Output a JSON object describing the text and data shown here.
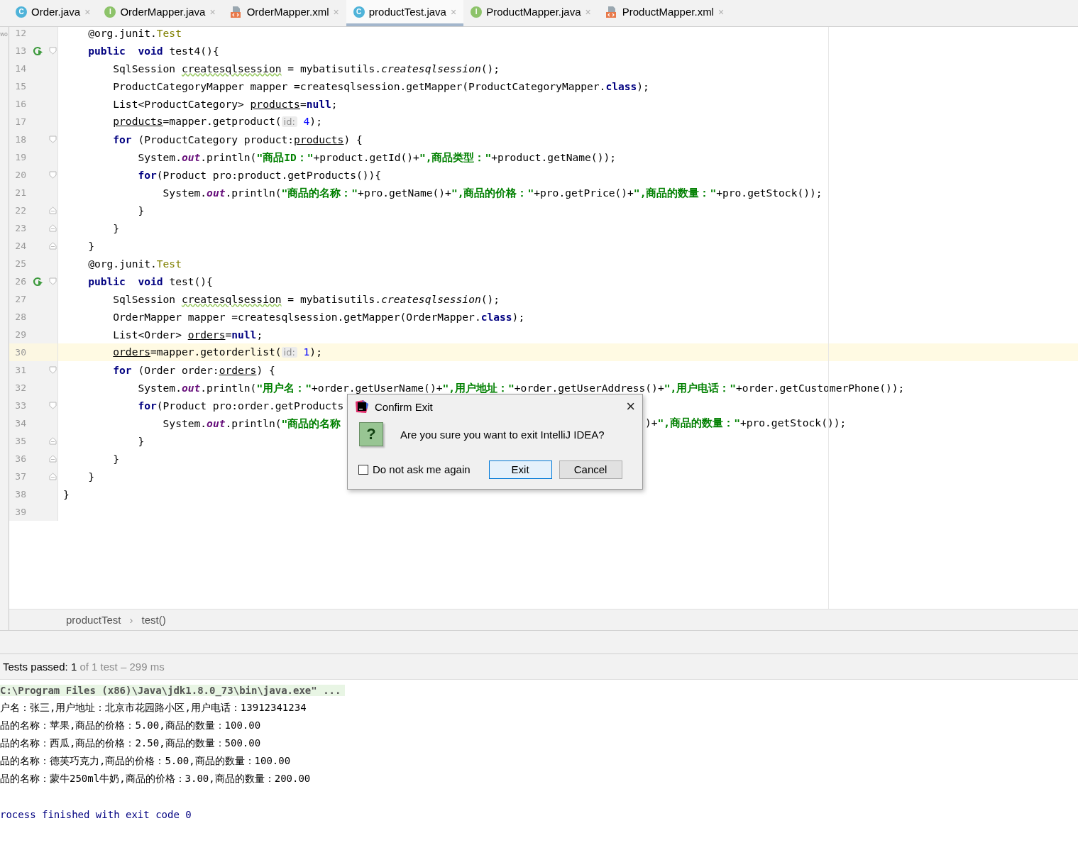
{
  "left_strip_text": "wo",
  "tabs": [
    {
      "label": "Order.java",
      "kind": "class",
      "badge": "C",
      "selected": false,
      "close": "×"
    },
    {
      "label": "OrderMapper.java",
      "kind": "interface",
      "badge": "I",
      "selected": false,
      "close": "×"
    },
    {
      "label": "OrderMapper.xml",
      "kind": "xml",
      "selected": false,
      "close": "×"
    },
    {
      "label": "productTest.java",
      "kind": "class",
      "badge": "C",
      "selected": true,
      "close": "×"
    },
    {
      "label": "ProductMapper.java",
      "kind": "interface",
      "badge": "I",
      "selected": false,
      "close": "×"
    },
    {
      "label": "ProductMapper.xml",
      "kind": "xml",
      "selected": false,
      "close": "×"
    }
  ],
  "editor": {
    "class_body": [
      {
        "n": "12",
        "tokens": [
          {
            "t": "@org.junit.",
            "kind": "plain"
          },
          {
            "t": "Test",
            "kind": "ann"
          }
        ]
      },
      {
        "n": "13",
        "run": true,
        "fold_open": true,
        "tokens": [
          {
            "t": "public  ",
            "kind": "kw"
          },
          {
            "t": "void",
            "kind": "kw"
          },
          {
            "t": " test4(){",
            "kind": "plain"
          }
        ],
        "children": [
          {
            "n": "14",
            "tokens": [
              {
                "t": "SqlSession ",
                "kind": "plain"
              },
              {
                "t": "createsqlsession",
                "kind": "wavy"
              },
              {
                "t": " = mybatisutils.",
                "kind": "plain"
              },
              {
                "t": "createsqlsession",
                "kind": "italic"
              },
              {
                "t": "();",
                "kind": "plain"
              }
            ]
          },
          {
            "n": "15",
            "tokens": [
              {
                "t": "ProductCategoryMapper mapper =createsqlsession.getMapper(ProductCategoryMapper.",
                "kind": "plain"
              },
              {
                "t": "class",
                "kind": "kw"
              },
              {
                "t": ");",
                "kind": "plain"
              }
            ]
          },
          {
            "n": "16",
            "tokens": [
              {
                "t": "List<ProductCategory> ",
                "kind": "plain"
              },
              {
                "t": "products",
                "kind": "under"
              },
              {
                "t": "=",
                "kind": "plain"
              },
              {
                "t": "null",
                "kind": "kw"
              },
              {
                "t": ";",
                "kind": "plain"
              }
            ]
          },
          {
            "n": "17",
            "tokens": [
              {
                "t": "products",
                "kind": "under"
              },
              {
                "t": "=mapper.getproduct(",
                "kind": "plain"
              },
              {
                "t": "id:",
                "kind": "hint"
              },
              {
                "t": " 4",
                "kind": "num"
              },
              {
                "t": ");",
                "kind": "plain"
              }
            ]
          },
          {
            "n": "18",
            "fold_open": true,
            "tokens": [
              {
                "t": "for",
                "kind": "kw"
              },
              {
                "t": " (ProductCategory product:",
                "kind": "plain"
              },
              {
                "t": "products",
                "kind": "under"
              },
              {
                "t": ") {",
                "kind": "plain"
              }
            ],
            "children": [
              {
                "n": "19",
                "tokens": [
                  {
                    "t": "System.",
                    "kind": "plain"
                  },
                  {
                    "t": "out",
                    "kind": "static"
                  },
                  {
                    "t": ".println(",
                    "kind": "plain"
                  },
                  {
                    "t": "\"商品ID：\"",
                    "kind": "str"
                  },
                  {
                    "t": "+product.getId()+",
                    "kind": "plain"
                  },
                  {
                    "t": "\",商品类型：\"",
                    "kind": "str"
                  },
                  {
                    "t": "+product.getName());",
                    "kind": "plain"
                  }
                ]
              },
              {
                "n": "20",
                "fold_open": true,
                "tokens": [
                  {
                    "t": "for",
                    "kind": "kw"
                  },
                  {
                    "t": "(Product pro:product.getProducts()){",
                    "kind": "plain"
                  }
                ],
                "children": [
                  {
                    "n": "21",
                    "tokens": [
                      {
                        "t": "System.",
                        "kind": "plain"
                      },
                      {
                        "t": "out",
                        "kind": "static"
                      },
                      {
                        "t": ".println(",
                        "kind": "plain"
                      },
                      {
                        "t": "\"商品的名称：\"",
                        "kind": "str"
                      },
                      {
                        "t": "+pro.getName()+",
                        "kind": "plain"
                      },
                      {
                        "t": "\",商品的价格：\"",
                        "kind": "str"
                      },
                      {
                        "t": "+pro.getPrice()+",
                        "kind": "plain"
                      },
                      {
                        "t": "\",商品的数量：\"",
                        "kind": "str"
                      },
                      {
                        "t": "+pro.getStock());",
                        "kind": "plain"
                      }
                    ]
                  }
                ]
              },
              {
                "n": "22",
                "fold_close": true,
                "tokens": [
                  {
                    "t": "}",
                    "kind": "plain"
                  }
                ]
              }
            ]
          },
          {
            "n": "23",
            "fold_close": true,
            "tokens": [
              {
                "t": "}",
                "kind": "plain"
              }
            ]
          }
        ]
      },
      {
        "n": "24",
        "fold_close": true,
        "tokens": [
          {
            "t": "}",
            "kind": "plain"
          }
        ]
      },
      {
        "n": "25",
        "tokens": [
          {
            "t": "@org.junit.",
            "kind": "plain"
          },
          {
            "t": "Test",
            "kind": "ann"
          }
        ]
      },
      {
        "n": "26",
        "run": true,
        "fold_open": true,
        "tokens": [
          {
            "t": "public  ",
            "kind": "kw"
          },
          {
            "t": "void",
            "kind": "kw"
          },
          {
            "t": " test(){",
            "kind": "plain"
          }
        ],
        "children": [
          {
            "n": "27",
            "tokens": [
              {
                "t": "SqlSession ",
                "kind": "plain"
              },
              {
                "t": "createsqlsession",
                "kind": "wavy"
              },
              {
                "t": " = mybatisutils.",
                "kind": "plain"
              },
              {
                "t": "createsqlsession",
                "kind": "italic"
              },
              {
                "t": "();",
                "kind": "plain"
              }
            ]
          },
          {
            "n": "28",
            "tokens": [
              {
                "t": "OrderMapper mapper =createsqlsession.getMapper(OrderMapper.",
                "kind": "plain"
              },
              {
                "t": "class",
                "kind": "kw"
              },
              {
                "t": ");",
                "kind": "plain"
              }
            ]
          },
          {
            "n": "29",
            "tokens": [
              {
                "t": "List<Order> ",
                "kind": "plain"
              },
              {
                "t": "orders",
                "kind": "under"
              },
              {
                "t": "=",
                "kind": "plain"
              },
              {
                "t": "null",
                "kind": "kw"
              },
              {
                "t": ";",
                "kind": "plain"
              }
            ]
          },
          {
            "n": "30",
            "current": true,
            "tokens": [
              {
                "t": "orders",
                "kind": "under"
              },
              {
                "t": "=mapper.getorderlist(",
                "kind": "plain"
              },
              {
                "t": "id:",
                "kind": "hint"
              },
              {
                "t": " 1",
                "kind": "num"
              },
              {
                "t": ");",
                "kind": "plain"
              }
            ]
          },
          {
            "n": "31",
            "fold_open": true,
            "tokens": [
              {
                "t": "for",
                "kind": "kw"
              },
              {
                "t": " (Order order:",
                "kind": "plain"
              },
              {
                "t": "orders",
                "kind": "under"
              },
              {
                "t": ") {",
                "kind": "plain"
              }
            ],
            "children": [
              {
                "n": "32",
                "tokens": [
                  {
                    "t": "System.",
                    "kind": "plain"
                  },
                  {
                    "t": "out",
                    "kind": "static"
                  },
                  {
                    "t": ".println(",
                    "kind": "plain"
                  },
                  {
                    "t": "\"用户名：\"",
                    "kind": "str"
                  },
                  {
                    "t": "+order.getUserName()+",
                    "kind": "plain"
                  },
                  {
                    "t": "\",用户地址：\"",
                    "kind": "str"
                  },
                  {
                    "t": "+order.getUserAddress()+",
                    "kind": "plain"
                  },
                  {
                    "t": "\",用户电话：\"",
                    "kind": "str"
                  },
                  {
                    "t": "+order.getCustomerPhone());",
                    "kind": "plain"
                  }
                ]
              },
              {
                "n": "33",
                "fold_open": true,
                "tokens": [
                  {
                    "t": "for",
                    "kind": "kw"
                  },
                  {
                    "t": "(Product pro:order.getProducts",
                    "kind": "plain"
                  }
                ],
                "children": [
                  {
                    "n": "34",
                    "tokens": [
                      {
                        "t": "System.",
                        "kind": "plain"
                      },
                      {
                        "t": "out",
                        "kind": "static"
                      },
                      {
                        "t": ".println(",
                        "kind": "plain"
                      },
                      {
                        "t": "\"商品的名称",
                        "kind": "str"
                      }
                    ],
                    "tail": [
                      {
                        "t": ")+",
                        "kind": "plain"
                      },
                      {
                        "t": "\",商品的数量：\"",
                        "kind": "str"
                      },
                      {
                        "t": "+pro.getStock());",
                        "kind": "plain"
                      }
                    ]
                  }
                ]
              },
              {
                "n": "35",
                "fold_close": true,
                "tokens": [
                  {
                    "t": "}",
                    "kind": "plain"
                  }
                ]
              }
            ]
          },
          {
            "n": "36",
            "fold_close": true,
            "tokens": [
              {
                "t": "}",
                "kind": "plain"
              }
            ]
          }
        ]
      },
      {
        "n": "37",
        "fold_close": true,
        "tokens": [
          {
            "t": "}",
            "kind": "plain"
          }
        ]
      }
    ],
    "lines_after": [
      {
        "n": "38",
        "tokens": [
          {
            "t": "}",
            "kind": "plain"
          }
        ]
      },
      {
        "n": "39"
      }
    ]
  },
  "breadcrumb": {
    "items": [
      "productTest",
      "test()"
    ],
    "separator": "›"
  },
  "run_panel": {
    "status": "Tests passed: ",
    "count": "1",
    "detail": " of 1 test – 299 ms"
  },
  "console": [
    {
      "text": "C:\\Program Files (x86)\\Java\\jdk1.8.0_73\\bin\\java.exe\" ...",
      "kind": "command"
    },
    {
      "text": "户名：张三,用户地址：北京市花园路小区,用户电话：13912341234",
      "kind": "output"
    },
    {
      "text": "品的名称：苹果,商品的价格：5.00,商品的数量：100.00",
      "kind": "output"
    },
    {
      "text": "品的名称：西瓜,商品的价格：2.50,商品的数量：500.00",
      "kind": "output"
    },
    {
      "text": "品的名称：德芙巧克力,商品的价格：5.00,商品的数量：100.00",
      "kind": "output"
    },
    {
      "text": "品的名称：蒙牛250ml牛奶,商品的价格：3.00,商品的数量：200.00",
      "kind": "output"
    },
    {
      "kind": "blank"
    },
    {
      "text": "rocess finished with exit code 0",
      "kind": "system"
    }
  ],
  "dialog": {
    "title": "Confirm Exit",
    "close": "×",
    "icon_glyph": "?",
    "message": "Are you sure you want to exit IntelliJ IDEA?",
    "checkbox": {
      "label": "Do not ask me again",
      "checked": false
    },
    "buttons": [
      {
        "label": "Exit",
        "default": true
      },
      {
        "label": "Cancel",
        "default": false
      }
    ]
  }
}
